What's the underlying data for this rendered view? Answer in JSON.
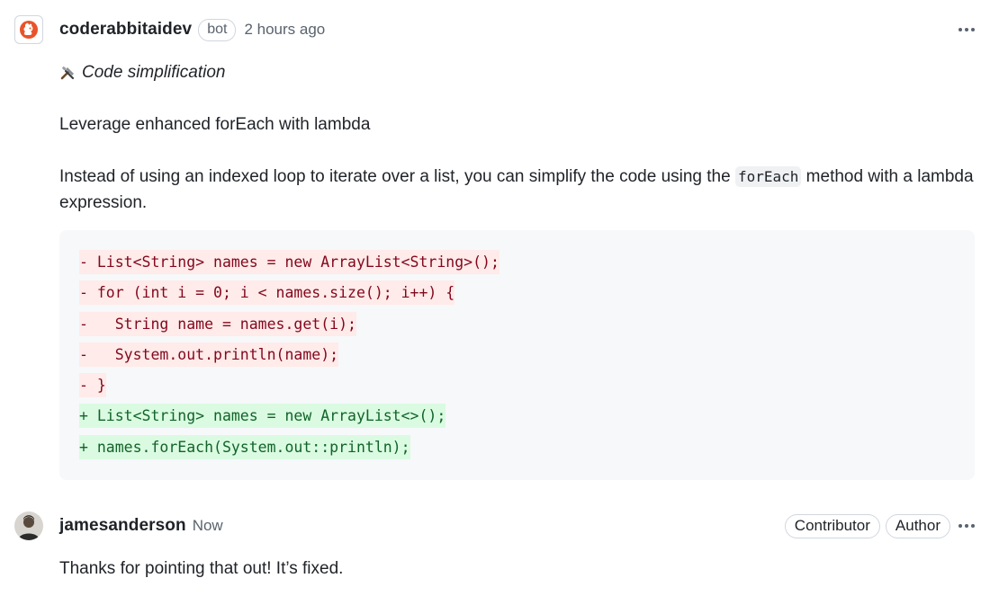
{
  "comments": [
    {
      "author": "coderabbitaidev",
      "badge": "bot",
      "time": "2 hours ago",
      "label": "Code simplification",
      "label_icon": "tools-icon",
      "title": "Leverage enhanced forEach with lambda",
      "description_before": "Instead of using an indexed loop to iterate over a list, you can simplify the code using the ",
      "description_code": "forEach",
      "description_after": " method with a lambda expression.",
      "code_lines": [
        {
          "type": "del",
          "text": "- List<String> names = new ArrayList<String>();"
        },
        {
          "type": "del",
          "text": "- for (int i = 0; i < names.size(); i++) {"
        },
        {
          "type": "del",
          "text": "-   String name = names.get(i);"
        },
        {
          "type": "del",
          "text": "-   System.out.println(name);"
        },
        {
          "type": "del",
          "text": "- }"
        },
        {
          "type": "add",
          "text": "+ List<String> names = new ArrayList<>();"
        },
        {
          "type": "add",
          "text": "+ names.forEach(System.out::println);"
        }
      ]
    },
    {
      "author": "jamesanderson",
      "time": "Now",
      "roles": [
        "Contributor",
        "Author"
      ],
      "body": "Thanks for pointing that out! It’s fixed."
    }
  ],
  "colors": {
    "deletion_bg": "#ffebe9",
    "deletion_text": "#82071e",
    "addition_bg": "#dafbe1",
    "addition_text": "#116329",
    "bot_brand": "#e8542a"
  }
}
